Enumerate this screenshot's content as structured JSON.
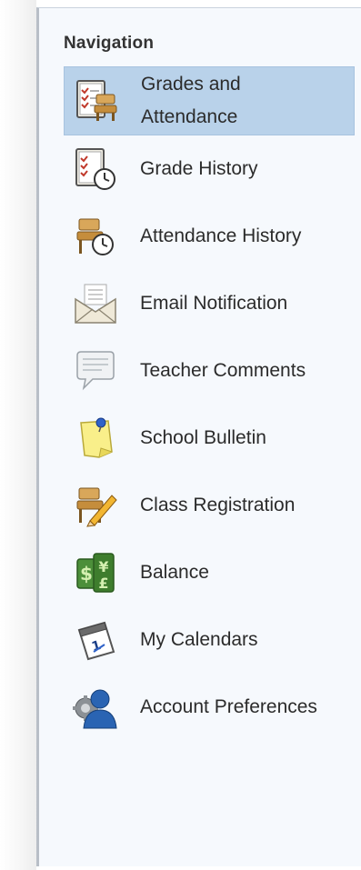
{
  "navigation": {
    "heading": "Navigation",
    "items": [
      {
        "label": "Grades and\nAttendance",
        "icon": "grades-attendance-icon",
        "active": true
      },
      {
        "label": "Grade History",
        "icon": "grade-history-icon",
        "active": false
      },
      {
        "label": "Attendance History",
        "icon": "attendance-history-icon",
        "active": false
      },
      {
        "label": "Email Notification",
        "icon": "email-envelope-icon",
        "active": false
      },
      {
        "label": "Teacher Comments",
        "icon": "speech-bubble-icon",
        "active": false
      },
      {
        "label": "School Bulletin",
        "icon": "pinned-note-icon",
        "active": false
      },
      {
        "label": "Class Registration",
        "icon": "desk-pencil-icon",
        "active": false
      },
      {
        "label": "Balance",
        "icon": "money-icon",
        "active": false
      },
      {
        "label": "My Calendars",
        "icon": "calendar-icon",
        "active": false
      },
      {
        "label": "Account Preferences",
        "icon": "user-gear-icon",
        "active": false
      }
    ]
  },
  "colors": {
    "active_background": "#b9d2ea",
    "panel_background": "#f6f9fd"
  }
}
